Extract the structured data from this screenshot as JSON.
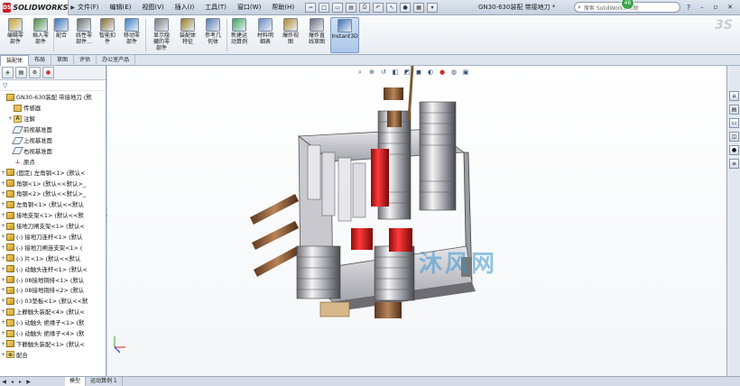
{
  "app": {
    "logo_text": "SOLIDWORKS",
    "logo_badge": "DS",
    "document_title": "GN30-630装配 带接地刀 *",
    "search_placeholder": "搜索 SolidWorks 帮助",
    "badge_count": "46"
  },
  "menus": [
    "文件(F)",
    "编辑(E)",
    "视图(V)",
    "插入(I)",
    "工具(T)",
    "窗口(W)",
    "帮助(H)"
  ],
  "ribbon": [
    {
      "label": "编辑零\n部件",
      "icon": "edit-component-icon"
    },
    {
      "label": "插入零\n部件",
      "icon": "insert-component-icon"
    },
    {
      "label": "配合",
      "icon": "mate-icon"
    },
    {
      "label": "线性零\n部件...",
      "icon": "linear-pattern-icon"
    },
    {
      "label": "智能扣\n件",
      "icon": "smart-fastener-icon"
    },
    {
      "label": "移动零\n部件",
      "icon": "move-component-icon"
    },
    {
      "label": "显示隐\n藏的零\n部件",
      "icon": "show-hidden-icon"
    },
    {
      "label": "装配体\n特征",
      "icon": "assembly-feature-icon"
    },
    {
      "label": "参考几\n何体",
      "icon": "reference-geometry-icon"
    },
    {
      "label": "新建运\n动算例",
      "icon": "motion-study-icon"
    },
    {
      "label": "材料明\n细表",
      "icon": "bom-icon"
    },
    {
      "label": "爆炸视\n图",
      "icon": "exploded-view-icon"
    },
    {
      "label": "爆炸直\n线草图",
      "icon": "explode-line-icon"
    },
    {
      "label": "Instant3D",
      "icon": "instant3d-icon"
    }
  ],
  "command_tabs": [
    "装配体",
    "布局",
    "草图",
    "评估",
    "办公室产品"
  ],
  "tree": [
    {
      "label": "GN30-630装配 带接地刀 (默",
      "icon": "assembly",
      "exp": "",
      "indent": 0
    },
    {
      "label": "传感器",
      "icon": "sensor",
      "exp": "",
      "indent": 1
    },
    {
      "label": "注解",
      "icon": "annotation",
      "exp": "+",
      "indent": 1
    },
    {
      "label": "前视基准面",
      "icon": "plane",
      "exp": "",
      "indent": 1
    },
    {
      "label": "上视基准面",
      "icon": "plane",
      "exp": "",
      "indent": 1
    },
    {
      "label": "右视基准面",
      "icon": "plane",
      "exp": "",
      "indent": 1
    },
    {
      "label": "原点",
      "icon": "origin",
      "exp": "",
      "indent": 1
    },
    {
      "label": "(固定) 左角钢<1> (默认<",
      "icon": "part",
      "exp": "+",
      "indent": 0
    },
    {
      "label": "角钢<1> (默认<<默认>_",
      "icon": "part",
      "exp": "+",
      "indent": 0
    },
    {
      "label": "角钢<2> (默认<<默认>_",
      "icon": "part",
      "exp": "+",
      "indent": 0
    },
    {
      "label": "左角钢<1> (默认<<默认",
      "icon": "part",
      "exp": "+",
      "indent": 0
    },
    {
      "label": "接地支架<1> (默认<<默",
      "icon": "part",
      "exp": "+",
      "indent": 0
    },
    {
      "label": "接地刀闸支架<1> (默认<",
      "icon": "part",
      "exp": "+",
      "indent": 0
    },
    {
      "label": "(-) 接地刀连杆<1> (默认",
      "icon": "part",
      "exp": "+",
      "indent": 0
    },
    {
      "label": "(-) 接地刀闸连支架<1> (",
      "icon": "part",
      "exp": "+",
      "indent": 0
    },
    {
      "label": "(-) 片<1> (默认<<默认",
      "icon": "part",
      "exp": "+",
      "indent": 0
    },
    {
      "label": "(-) 动触头连杆<1> (默认<",
      "icon": "part",
      "exp": "+",
      "indent": 0
    },
    {
      "label": "(-) 08接地铜排<1> (默认",
      "icon": "part",
      "exp": "+",
      "indent": 0
    },
    {
      "label": "(-) 08接地铜排<2> (默认",
      "icon": "part",
      "exp": "+",
      "indent": 0
    },
    {
      "label": "(-) 03垫板<1> (默认<<默",
      "icon": "part",
      "exp": "+",
      "indent": 0
    },
    {
      "label": "上静触头装配<4> (默认<",
      "icon": "asm",
      "exp": "+",
      "indent": 0
    },
    {
      "label": "(-) 动触头 绝缘子<1> (默",
      "icon": "asm",
      "exp": "+",
      "indent": 0
    },
    {
      "label": "(-) 动触头 绝缘子<4> (默",
      "icon": "asm",
      "exp": "+",
      "indent": 0
    },
    {
      "label": "下静触头装配<1> (默认<",
      "icon": "asm",
      "exp": "+",
      "indent": 0
    },
    {
      "label": "配合",
      "icon": "mates",
      "exp": "+",
      "indent": 0
    }
  ],
  "bottom_tabs": [
    "模型",
    "运动算例 1"
  ],
  "watermark": "沐风网",
  "colors": {
    "accent": "#c61f26",
    "highlight_red": "#e01a1a",
    "bronze": "#a0704a"
  }
}
